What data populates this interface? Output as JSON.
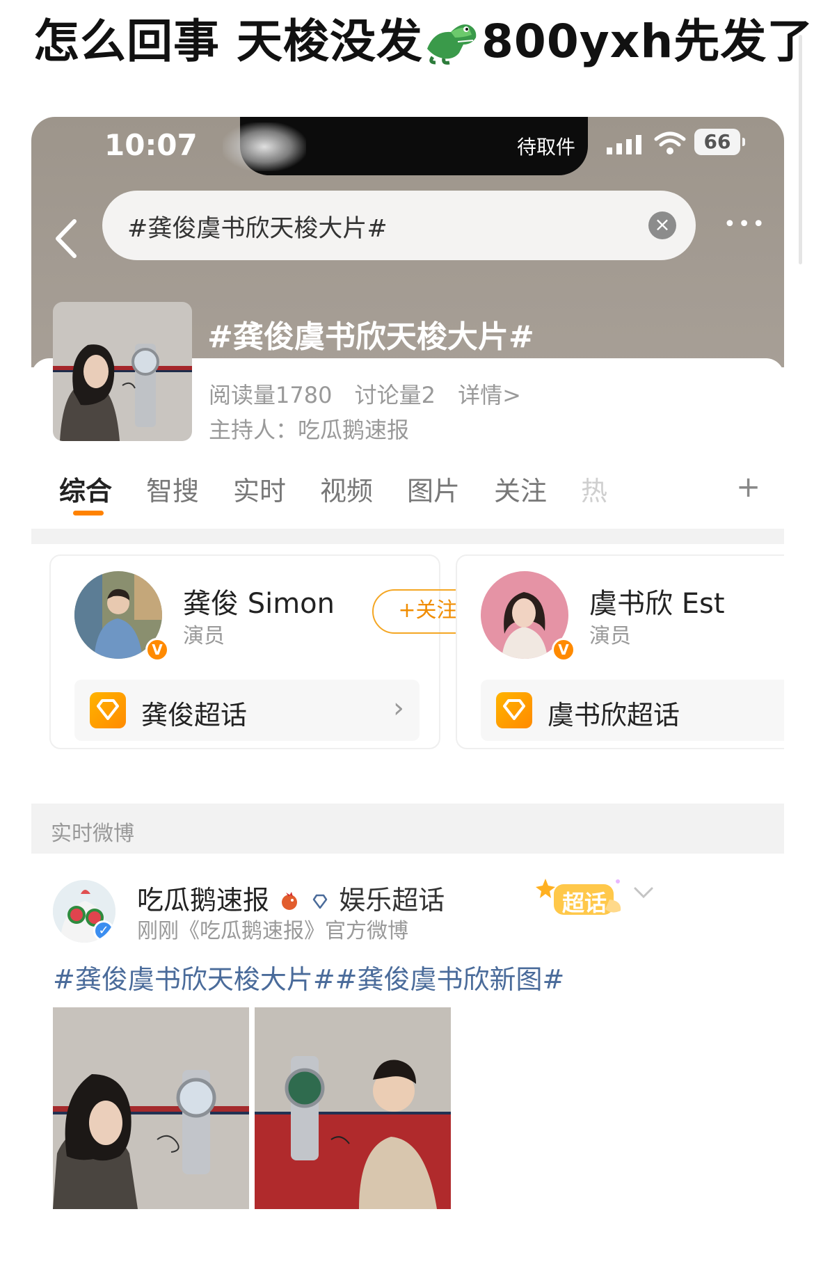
{
  "caption": {
    "text_before": "怎么回事 天梭没发",
    "emoji": "crocodile-emoji",
    "text_after": "800yxh先发了"
  },
  "status_bar": {
    "time": "10:07",
    "notification": "待取件",
    "battery": "66"
  },
  "search": {
    "query": "#龚俊虞书欣天梭大片#"
  },
  "topic": {
    "title": "#龚俊虞书欣天梭大片#",
    "reads": "阅读量1780",
    "discussions": "讨论量2",
    "details": "详情>",
    "host": "主持人：吃瓜鹅速报"
  },
  "tabs": [
    "综合",
    "智搜",
    "实时",
    "视频",
    "图片",
    "关注",
    "热"
  ],
  "stars": [
    {
      "name": "龚俊 Simon",
      "role": "演员",
      "follow": "+关注",
      "supertopic": "龚俊超话",
      "badge": "V"
    },
    {
      "name": "虞书欣 Est",
      "role": "演员",
      "supertopic": "虞书欣超话",
      "badge": "V"
    }
  ],
  "section": {
    "label": "实时微博"
  },
  "post": {
    "author": "吃瓜鹅速报",
    "group": "娱乐超话",
    "meta": "刚刚《吃瓜鹅速报》官方微博",
    "tag_label": "超话",
    "text": "#龚俊虞书欣天梭大片##龚俊虞书欣新图#"
  },
  "colors": {
    "accent": "#ff8200",
    "topic_link": "#4a6b9a",
    "header_bg": "#a39b92"
  }
}
